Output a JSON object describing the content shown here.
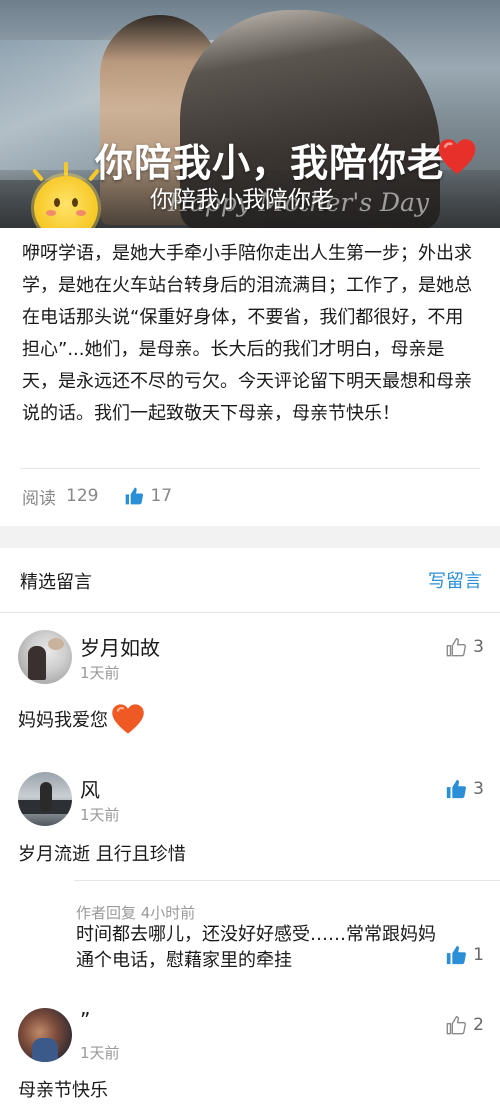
{
  "hero": {
    "headline": "你陪我小，我陪你老",
    "caption": "你陪我小我陪你老",
    "watermark": "Happy Mother's Day"
  },
  "article": {
    "body": "咿呀学语，是她大手牵小手陪你走出人生第一步；外出求学，是她在火车站台转身后的泪流满目；工作了，是她总在电话那头说“保重好身体，不要省，我们都很好，不用担心”...她们，是母亲。长大后的我们才明白，母亲是天，是永远还不尽的亏欠。今天评论留下明天最想和母亲说的话。我们一起致敬天下母亲，母亲节快乐！",
    "read_label": "阅读",
    "read_count": "129",
    "like_count": "17"
  },
  "comments_section": {
    "title": "精选留言",
    "write_label": "写留言"
  },
  "comments": [
    {
      "name": "岁月如故",
      "time": "1天前",
      "text": "妈妈我爱您",
      "likes": "3",
      "liked": false
    },
    {
      "name": "风",
      "time": "1天前",
      "text": "岁月流逝 且行且珍惜",
      "likes": "3",
      "liked": true,
      "reply": {
        "meta": "作者回复 4小时前",
        "text": "时间都去哪儿，还没好好感受……常常跟妈妈通个电话，慰藉家里的牵挂",
        "likes": "1",
        "liked": true
      }
    },
    {
      "name": "”",
      "time": "1天前",
      "text": "母亲节快乐",
      "likes": "2",
      "liked": false
    }
  ],
  "colors": {
    "accent": "#2a8fd6",
    "like_active": "#2a8fd6",
    "like_inactive": "#888888",
    "heart": "#ef5a24"
  },
  "icons": {
    "like": "thumbs-up-icon",
    "heart": "heart-icon",
    "sun": "smiling-sun-icon"
  }
}
